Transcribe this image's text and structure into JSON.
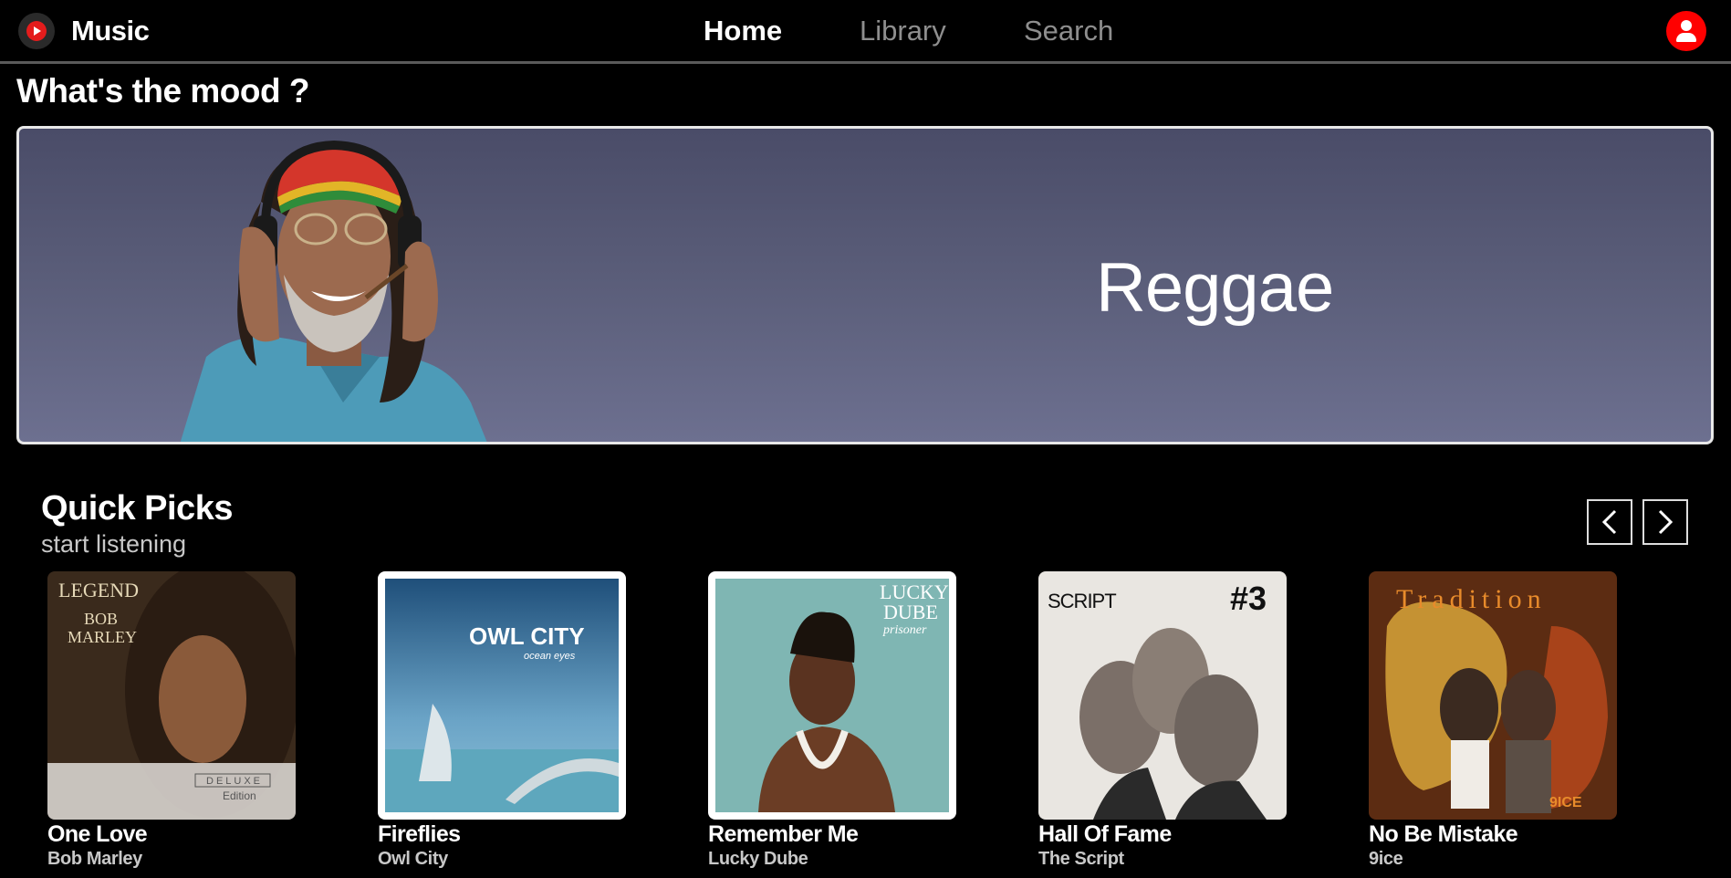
{
  "app": {
    "title": "Music"
  },
  "nav": {
    "home": "Home",
    "library": "Library",
    "search": "Search"
  },
  "mood": {
    "heading": "What's the mood ?",
    "genre": "Reggae"
  },
  "quick_picks": {
    "title": "Quick Picks",
    "subtitle": "start listening",
    "items": [
      {
        "title": "One Love",
        "artist": "Bob Marley",
        "cover_text_1": "LEGEND",
        "cover_text_2": "BOB",
        "cover_text_3": "MARLEY",
        "cover_text_4": "DELUXE",
        "cover_text_5": "Edition"
      },
      {
        "title": "Fireflies",
        "artist": "Owl City",
        "cover_text_1": "OWL CITY",
        "cover_text_2": "ocean eyes"
      },
      {
        "title": "Remember Me",
        "artist": "Lucky Dube",
        "cover_text_1": "LUCKY",
        "cover_text_2": "DUBE",
        "cover_text_3": "prisoner"
      },
      {
        "title": "Hall Of Fame",
        "artist": "The Script",
        "cover_text_1": "SCRIPT",
        "cover_text_2": "#3"
      },
      {
        "title": "No Be Mistake",
        "artist": "9ice",
        "cover_text_1": "Tradition",
        "cover_text_2": "9ICE"
      }
    ]
  },
  "colors": {
    "accent": "#ff0000",
    "background": "#000000",
    "banner": "#5b5e7a",
    "muted_text": "#8e8e8e"
  }
}
